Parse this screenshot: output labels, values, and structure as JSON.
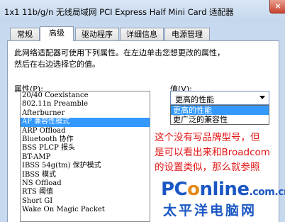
{
  "window": {
    "title": "1x1 11b/g/n 无线局域网 PCI Express Half Mini Card 适配器",
    "close_label": "×"
  },
  "tabs": [
    {
      "label": "常规"
    },
    {
      "label": "高级",
      "active": true
    },
    {
      "label": "驱动程序"
    },
    {
      "label": "详细信息"
    },
    {
      "label": "电源管理"
    }
  ],
  "description": [
    "此网络适配器可使用下列属性。在左边单击您想更改的属性，",
    "然后在右边选择它的值。"
  ],
  "property_label": "属性(P):",
  "value_label": "值(V):",
  "properties": [
    "20/40 Coexistance",
    "802.11n Preamble",
    "Afterburner",
    "AP 兼容性模式",
    "ARP Offload",
    "Bluetooth 协作",
    "BSS PLCP 报头",
    "BT-AMP",
    "IBSS 54g(tm) 保护模式",
    "IBSS 模式",
    "NS Offload",
    "RTS 阈值",
    "Short GI",
    "Wake On Magic Packet"
  ],
  "selected_property": "AP 兼容性模式",
  "value_select": {
    "current": "更高的性能",
    "options": [
      "更高的性能",
      "更广泛的兼容性"
    ],
    "highlighted": "更高的性能"
  },
  "annotation": [
    "这个没有写品牌型号，但",
    "是可以看出来和Broadcom",
    "的设置类似，那么就参照"
  ],
  "watermark": {
    "logo_prefix": "PC",
    "logo_o": "o",
    "logo_suffix": "nline",
    "logo_tld": ".com.cn",
    "subtitle": "太平洋电脑网"
  },
  "colors": {
    "selection": "#3399ff",
    "annotation": "#e11414",
    "watermark_blue": "#1b57c4",
    "watermark_orange": "#e38a1b"
  }
}
